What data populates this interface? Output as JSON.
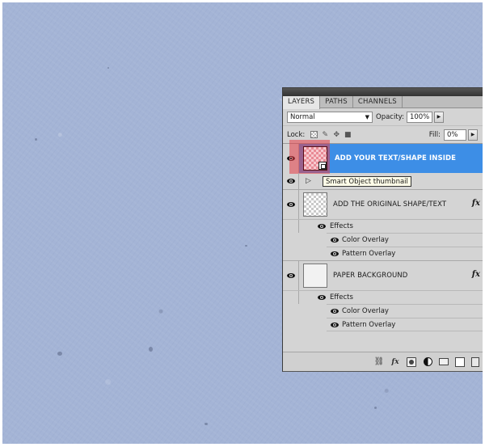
{
  "panel": {
    "tabs": [
      "LAYERS",
      "PATHS",
      "CHANNELS"
    ],
    "active_tab": "LAYERS",
    "blend_mode": "Normal",
    "opacity_label": "Opacity:",
    "opacity_value": "100%",
    "lock_label": "Lock:",
    "fill_label": "Fill:",
    "fill_value": "0%"
  },
  "layers": [
    {
      "name": "ADD YOUR TEXT/SHAPE INSIDE",
      "selected": true,
      "visible": true,
      "type": "smart-object"
    },
    {
      "name": "ADD THE ORIGINAL SHAPE/TEXT",
      "selected": false,
      "visible": true,
      "fx": "fx",
      "effects_label": "Effects",
      "effects": [
        "Color Overlay",
        "Pattern Overlay"
      ]
    },
    {
      "name": "PAPER BACKGROUND",
      "selected": false,
      "visible": true,
      "fx": "fx",
      "effects_label": "Effects",
      "effects": [
        "Color Overlay",
        "Pattern Overlay"
      ]
    }
  ],
  "tooltip": "Smart Object thumbnail",
  "bottom_bar": {
    "icons": [
      "link-layers-icon",
      "layer-style-fx-icon",
      "add-mask-icon",
      "adjustment-layer-icon",
      "new-group-icon",
      "new-layer-icon",
      "delete-layer-icon"
    ],
    "fx_label": "fx"
  },
  "colors": {
    "canvas": "#a4b4d6",
    "selection": "#3d8ee6",
    "highlight": "#e63c46"
  }
}
